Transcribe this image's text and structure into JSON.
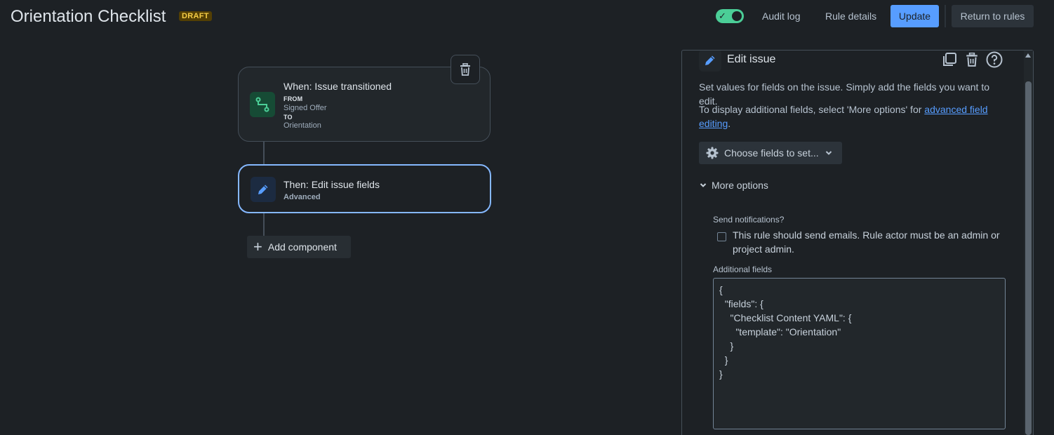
{
  "header": {
    "title": "Orientation Checklist",
    "status_badge": "DRAFT",
    "toggle_state": "on",
    "buttons": {
      "audit_log": "Audit log",
      "rule_details": "Rule details",
      "update": "Update",
      "return": "Return to rules"
    },
    "accent_color": "#579dff"
  },
  "flow": {
    "trigger": {
      "title": "When: Issue transitioned",
      "from_label": "FROM",
      "from_value": "Signed Offer",
      "to_label": "TO",
      "to_value": "Orientation",
      "icon": "transition-icon"
    },
    "action": {
      "title": "Then: Edit issue fields",
      "subtitle": "Advanced",
      "icon": "pencil-icon"
    },
    "add_component": "Add component"
  },
  "panel": {
    "title": "Edit issue",
    "description": "Set values for fields on the issue. Simply add the fields you want to edit.",
    "more_info_prefix": "To display additional fields, select 'More options' for ",
    "more_info_link": "advanced field editing",
    "more_info_suffix": ".",
    "choose_fields": "Choose fields to set...",
    "more_options": "More options",
    "send_notifications_label": "Send notifications?",
    "send_notifications_text": "This rule should send emails. Rule actor must be an admin or project admin.",
    "send_notifications_checked": false,
    "additional_fields_label": "Additional fields",
    "additional_fields_value": "{\n  \"fields\": {\n    \"Checklist Content YAML\": {\n      \"template\": \"Orientation\"\n    }\n  }\n}"
  }
}
